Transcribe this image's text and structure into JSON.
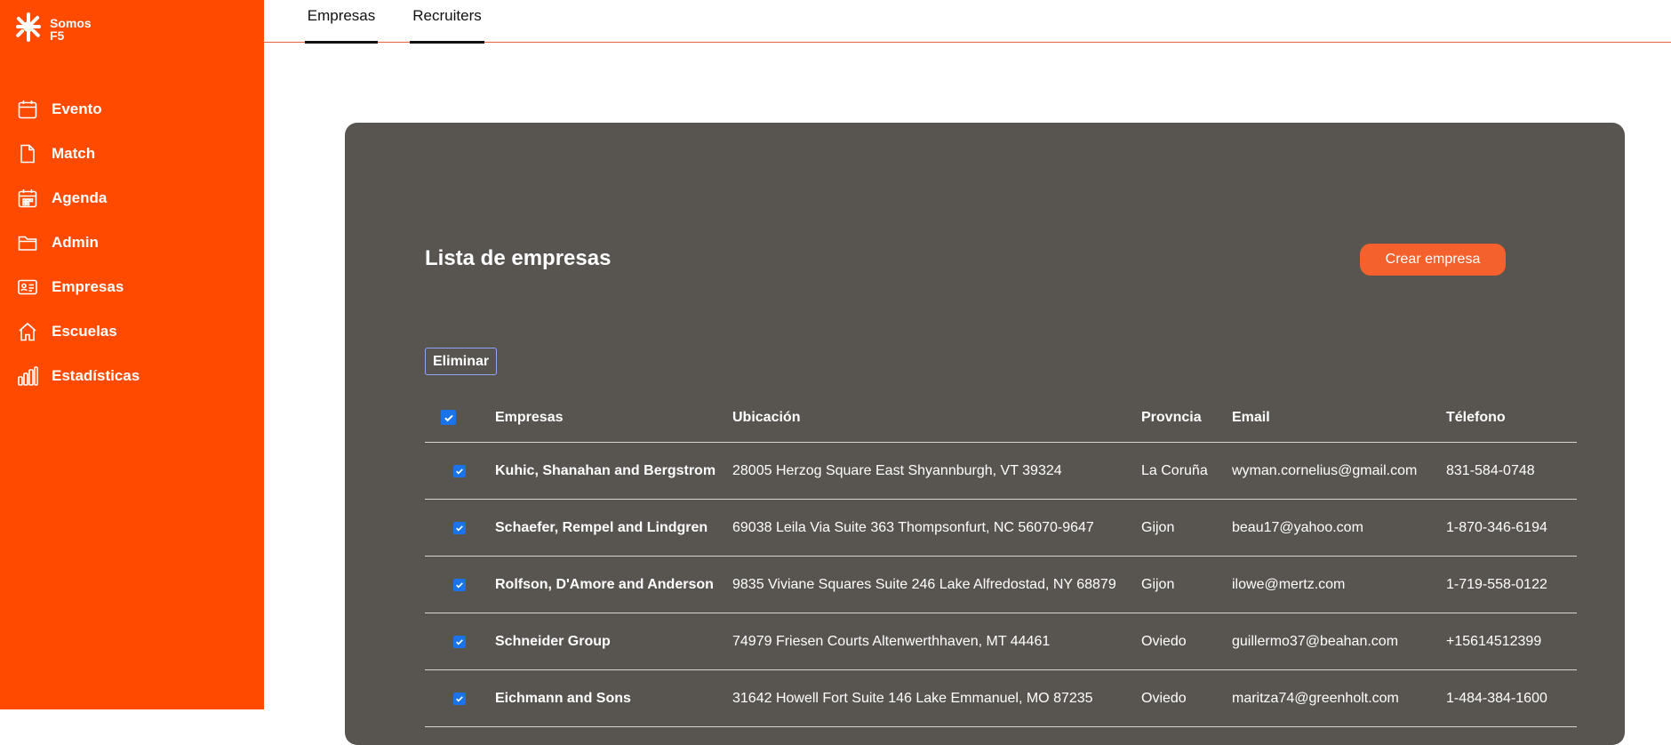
{
  "app": {
    "logo_text_line1": "Somos",
    "logo_text_line2": "F5",
    "brand_color": "#ff4a00",
    "accent_color": "#f4612d",
    "panel_color": "#585550"
  },
  "sidebar": {
    "items": [
      {
        "label": "Evento",
        "icon": "calendar-icon"
      },
      {
        "label": "Match",
        "icon": "document-icon"
      },
      {
        "label": "Agenda",
        "icon": "calendar-grid-icon"
      },
      {
        "label": "Admin",
        "icon": "folder-icon"
      },
      {
        "label": "Empresas",
        "icon": "id-card-icon"
      },
      {
        "label": "Escuelas",
        "icon": "home-icon"
      },
      {
        "label": "Estadísticas",
        "icon": "bar-chart-icon"
      }
    ]
  },
  "tabs": [
    {
      "label": "Empresas",
      "active": true
    },
    {
      "label": "Recruiters",
      "active": true
    }
  ],
  "main": {
    "title": "Lista de empresas",
    "create_button": "Crear empresa",
    "delete_button": "Eliminar"
  },
  "table": {
    "headers": [
      "Empresas",
      "Ubicación",
      "Provncia",
      "Email",
      "Télefono"
    ],
    "header_checked": true,
    "rows": [
      {
        "checked": true,
        "name": "Kuhic, Shanahan and Bergstrom",
        "location": "28005 Herzog Square East Shyannburgh, VT 39324",
        "province": "La Coruña",
        "email": "wyman.cornelius@gmail.com",
        "phone": "831-584-0748"
      },
      {
        "checked": true,
        "name": "Schaefer, Rempel and Lindgren",
        "location": "69038 Leila Via Suite 363 Thompsonfurt, NC 56070-9647",
        "province": "Gijon",
        "email": "beau17@yahoo.com",
        "phone": "1-870-346-6194"
      },
      {
        "checked": true,
        "name": "Rolfson, D'Amore and Anderson",
        "location": "9835 Viviane Squares Suite 246 Lake Alfredostad, NY 68879",
        "province": "Gijon",
        "email": "ilowe@mertz.com",
        "phone": "1-719-558-0122"
      },
      {
        "checked": true,
        "name": "Schneider Group",
        "location": "74979 Friesen Courts Altenwerthhaven, MT 44461",
        "province": "Oviedo",
        "email": "guillermo37@beahan.com",
        "phone": "+15614512399"
      },
      {
        "checked": true,
        "name": "Eichmann and Sons",
        "location": "31642 Howell Fort Suite 146 Lake Emmanuel, MO 87235",
        "province": "Oviedo",
        "email": "maritza74@greenholt.com",
        "phone": "1-484-384-1600"
      }
    ]
  }
}
